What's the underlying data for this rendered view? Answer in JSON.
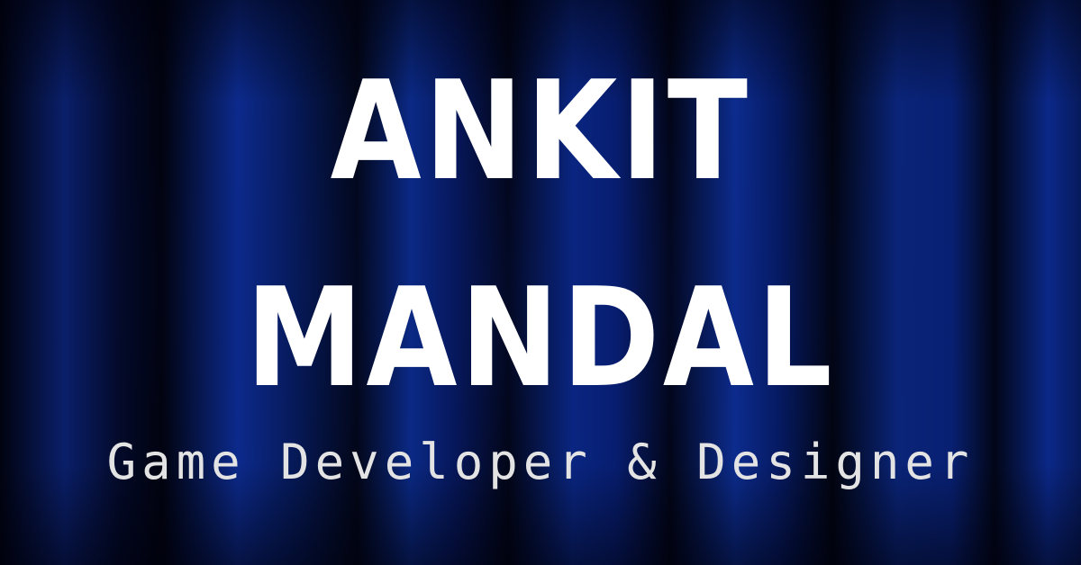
{
  "banner": {
    "title_line_1": "ANKIT",
    "title_line_2": "MANDAL",
    "subtitle": "Game Developer & Designer"
  },
  "colors": {
    "background_dark": "#02061a",
    "background_blue": "#0b2a86",
    "title_text": "#ffffff",
    "subtitle_text": "#e3e3e3"
  }
}
